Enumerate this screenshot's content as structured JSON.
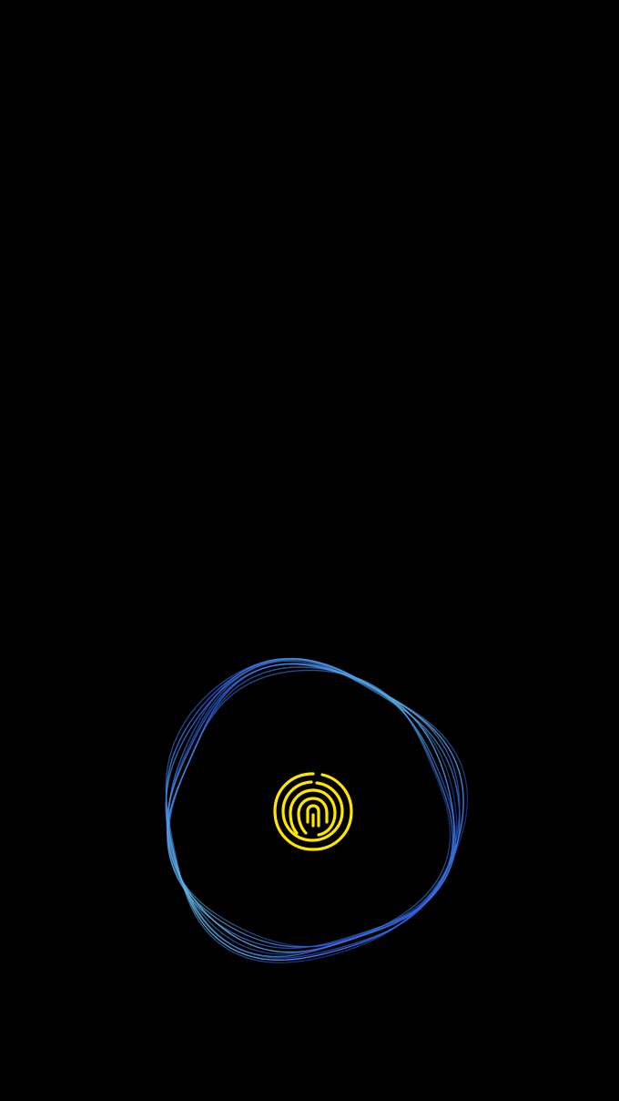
{
  "screen": {
    "background_color": "#000000"
  },
  "unlock_animation": {
    "gradient_colors": [
      "#2f5cf0",
      "#1f47e0",
      "#6ad0ec"
    ]
  },
  "fingerprint_sensor": {
    "icon": "fingerprint-icon",
    "color": "#ffe600"
  }
}
